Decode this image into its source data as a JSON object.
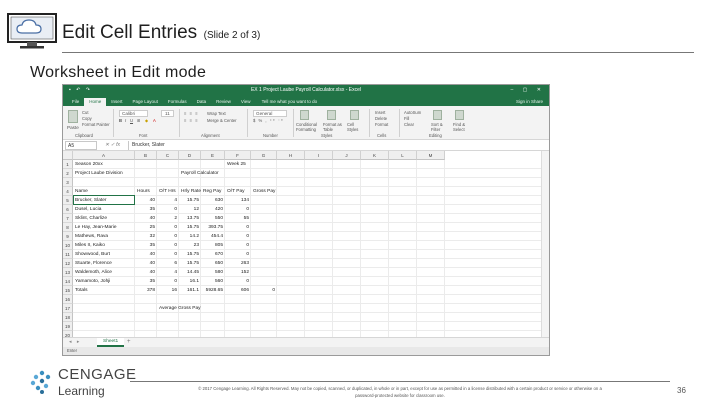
{
  "slide": {
    "title": "Edit Cell Entries",
    "subtitle": "(Slide 2 of 3)",
    "heading": "Worksheet in Edit mode",
    "page_number": "36",
    "copyright_line1": "© 2017 Cengage Learning. All Rights Reserved. May not be copied, scanned, or duplicated, in whole or in part, except for use as permitted in a license distributed with a certain product or service or otherwise on a",
    "copyright_line2": "password-protected website for classroom use.",
    "logo": {
      "top": "CENGAGE",
      "bottom": "Learning"
    }
  },
  "excel": {
    "window_title": "EX 1 Project Laube Payroll Calculator.xlsx - Excel",
    "tabs": [
      "File",
      "Home",
      "Insert",
      "Page Layout",
      "Formulas",
      "Data",
      "Review",
      "View"
    ],
    "active_tab": "Home",
    "tell_me": "Tell me what you want to do",
    "account": "Sign in   Share",
    "ribbon": {
      "paste": "Paste",
      "cut": "Cut",
      "copy": "Copy",
      "format_painter": "Format Painter",
      "clipboard": "Clipboard",
      "font_name": "Calibri",
      "font_size": "11",
      "font": "Font",
      "alignment": "Alignment",
      "wrap_text": "Wrap Text",
      "merge_center": "Merge & Center",
      "number_format": "General",
      "number": "Number",
      "conditional_formatting": "Conditional Formatting",
      "format_as_table": "Format as Table",
      "cell_styles": "Cell Styles",
      "styles": "Styles",
      "insert": "Insert",
      "delete": "Delete",
      "format": "Format",
      "cells": "Cells",
      "autosum": "AutoSum",
      "fill": "Fill",
      "clear": "Clear",
      "sort_filter": "Sort & Filter",
      "find_select": "Find & Select",
      "editing": "Editing"
    },
    "name_box": "A5",
    "formula_value": "Brucker, Slater",
    "columns": [
      "A",
      "B",
      "C",
      "D",
      "E",
      "F",
      "G",
      "H",
      "I",
      "J",
      "K",
      "L",
      "M"
    ],
    "row_numbers": [
      "1",
      "2",
      "3",
      "4",
      "5",
      "6",
      "7",
      "8",
      "9",
      "10",
      "11",
      "12",
      "13",
      "14",
      "15",
      "16",
      "17",
      "18",
      "19",
      "20",
      "21",
      "22",
      "23",
      "24"
    ],
    "rows": [
      [
        "Season 20xx",
        "",
        "",
        "",
        "",
        "Week 25",
        ""
      ],
      [
        "Project Laube Division",
        "",
        "",
        "Payroll Calculator",
        "",
        "",
        ""
      ],
      [
        "",
        "",
        "",
        "",
        "",
        "",
        ""
      ],
      [
        "Name",
        "Hours",
        "O/T Hrs",
        "Hrly Rate",
        "Reg Pay",
        "O/T Pay",
        "Gross Pay"
      ],
      [
        "Brucker, Slater",
        "40",
        "4",
        "15.75",
        "630",
        "134",
        ""
      ],
      [
        "Dusel, Lucia",
        "35",
        "0",
        "12",
        "420",
        "0",
        ""
      ],
      [
        "Sklint, Charlize",
        "40",
        "2",
        "13.75",
        "550",
        "55",
        ""
      ],
      [
        "Le Hay, Jean-Marie",
        "25",
        "0",
        "15.75",
        "393.75",
        "0",
        ""
      ],
      [
        "Mathews, Rava",
        "32",
        "0",
        "14.2",
        "454.4",
        "0",
        ""
      ],
      [
        "Miles II, Kaiko",
        "35",
        "0",
        "23",
        "805",
        "0",
        ""
      ],
      [
        "Showwood, Burt",
        "40",
        "0",
        "15.75",
        "670",
        "0",
        ""
      ],
      [
        "Stuarte, Florence",
        "40",
        "6",
        "15.75",
        "650",
        "263",
        ""
      ],
      [
        "Waldemoth, Alice",
        "40",
        "4",
        "14.45",
        "580",
        "152",
        ""
      ],
      [
        "Yamamoto, Johji",
        "35",
        "0",
        "16.1",
        "560",
        "0",
        ""
      ],
      [
        "Totals",
        "378",
        "16",
        "161.1",
        "5928.65",
        "606",
        "0"
      ],
      [
        "",
        "",
        "",
        "",
        "",
        "",
        ""
      ],
      [
        "",
        "",
        "Average Gross Pay",
        "",
        "",
        "",
        ""
      ]
    ],
    "sheet_tab": "Sheet1",
    "sheet_add": "+",
    "status": "Enter"
  }
}
